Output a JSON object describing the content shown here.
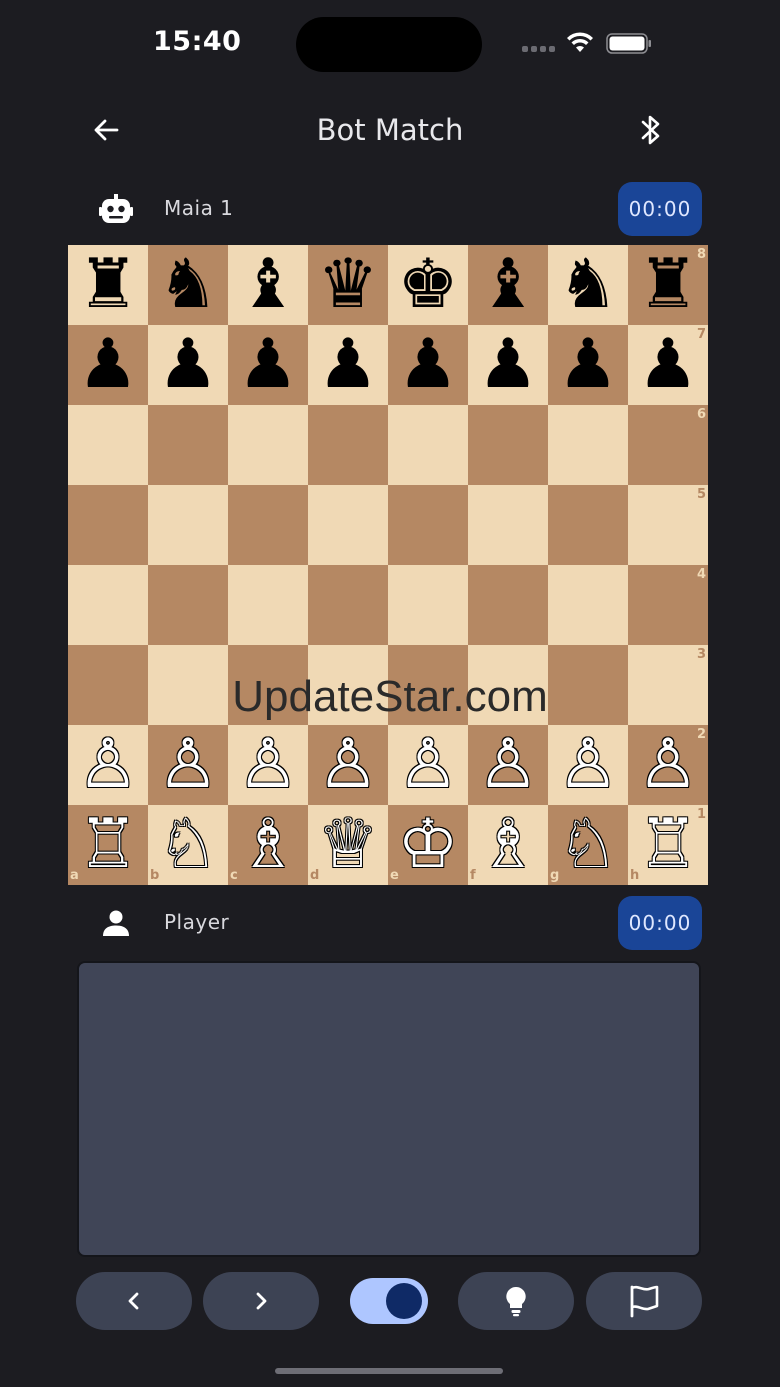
{
  "status_bar": {
    "time": "15:40"
  },
  "header": {
    "title": "Bot Match"
  },
  "opponent": {
    "name": "Maia 1",
    "clock": "00:00"
  },
  "player": {
    "name": "Player",
    "clock": "00:00"
  },
  "board": {
    "ranks": [
      [
        {
          "p": "♜",
          "c": "b"
        },
        {
          "p": "♞",
          "c": "b"
        },
        {
          "p": "♝",
          "c": "b"
        },
        {
          "p": "♛",
          "c": "b"
        },
        {
          "p": "♚",
          "c": "b"
        },
        {
          "p": "♝",
          "c": "b"
        },
        {
          "p": "♞",
          "c": "b"
        },
        {
          "p": "♜",
          "c": "b"
        }
      ],
      [
        {
          "p": "♟",
          "c": "b"
        },
        {
          "p": "♟",
          "c": "b"
        },
        {
          "p": "♟",
          "c": "b"
        },
        {
          "p": "♟",
          "c": "b"
        },
        {
          "p": "♟",
          "c": "b"
        },
        {
          "p": "♟",
          "c": "b"
        },
        {
          "p": "♟",
          "c": "b"
        },
        {
          "p": "♟",
          "c": "b"
        }
      ],
      [
        null,
        null,
        null,
        null,
        null,
        null,
        null,
        null
      ],
      [
        null,
        null,
        null,
        null,
        null,
        null,
        null,
        null
      ],
      [
        null,
        null,
        null,
        null,
        null,
        null,
        null,
        null
      ],
      [
        null,
        null,
        null,
        null,
        null,
        null,
        null,
        null
      ],
      [
        {
          "p": "♙",
          "c": "w"
        },
        {
          "p": "♙",
          "c": "w"
        },
        {
          "p": "♙",
          "c": "w"
        },
        {
          "p": "♙",
          "c": "w"
        },
        {
          "p": "♙",
          "c": "w"
        },
        {
          "p": "♙",
          "c": "w"
        },
        {
          "p": "♙",
          "c": "w"
        },
        {
          "p": "♙",
          "c": "w"
        }
      ],
      [
        {
          "p": "♖",
          "c": "w"
        },
        {
          "p": "♘",
          "c": "w"
        },
        {
          "p": "♗",
          "c": "w"
        },
        {
          "p": "♕",
          "c": "w"
        },
        {
          "p": "♔",
          "c": "w"
        },
        {
          "p": "♗",
          "c": "w"
        },
        {
          "p": "♘",
          "c": "w"
        },
        {
          "p": "♖",
          "c": "w"
        }
      ]
    ],
    "rank_labels": [
      "8",
      "7",
      "6",
      "5",
      "4",
      "3",
      "2",
      "1"
    ],
    "file_labels": [
      "a",
      "b",
      "c",
      "d",
      "e",
      "f",
      "g",
      "h"
    ]
  },
  "watermark": "UpdateStar.com",
  "toolbar": {
    "prev_icon": "chevron-left-icon",
    "next_icon": "chevron-right-icon",
    "toggle_on": true,
    "hint_icon": "lightbulb-icon",
    "resign_icon": "flag-icon"
  }
}
